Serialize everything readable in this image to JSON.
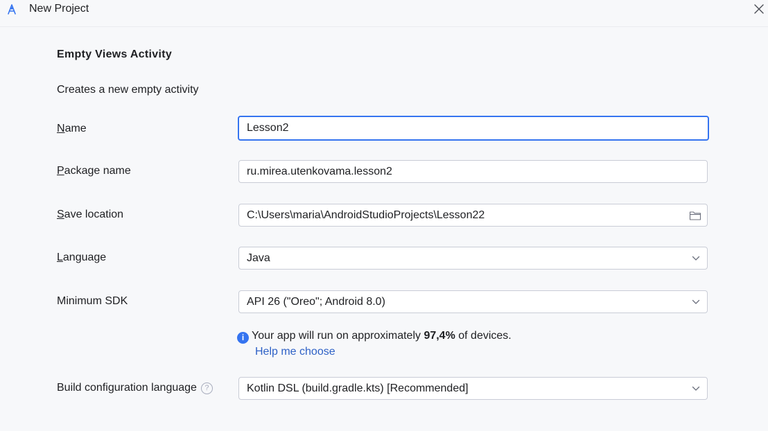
{
  "window": {
    "title": "New Project",
    "logo_icon": "android-studio-logo-icon",
    "close_icon": "close-icon"
  },
  "template": {
    "heading": "Empty Views Activity",
    "description": "Creates a new empty activity"
  },
  "form": {
    "name": {
      "mnemonic": "N",
      "label_rest": "ame",
      "value": "Lesson2"
    },
    "package": {
      "mnemonic": "P",
      "label_rest": "ackage name",
      "value": "ru.mirea.utenkovama.lesson2"
    },
    "save_location": {
      "mnemonic": "S",
      "label_rest": "ave location",
      "value": "C:\\Users\\maria\\AndroidStudioProjects\\Lesson22",
      "icon": "folder-icon"
    },
    "language": {
      "mnemonic": "L",
      "label_rest": "anguage",
      "value": "Java"
    },
    "min_sdk": {
      "label": "Minimum SDK",
      "value": "API 26 (\"Oreo\"; Android 8.0)"
    },
    "build_config": {
      "label": "Build configuration language",
      "value": "Kotlin DSL (build.gradle.kts) [Recommended]",
      "help_icon": "?"
    }
  },
  "info": {
    "icon": "i",
    "prefix": "Your app will run on approximately ",
    "percent": "97,4%",
    "suffix": " of devices.",
    "help_link": "Help me choose"
  },
  "colors": {
    "accent": "#3574f0",
    "link": "#2e61c6",
    "background": "#f7f8fa"
  }
}
